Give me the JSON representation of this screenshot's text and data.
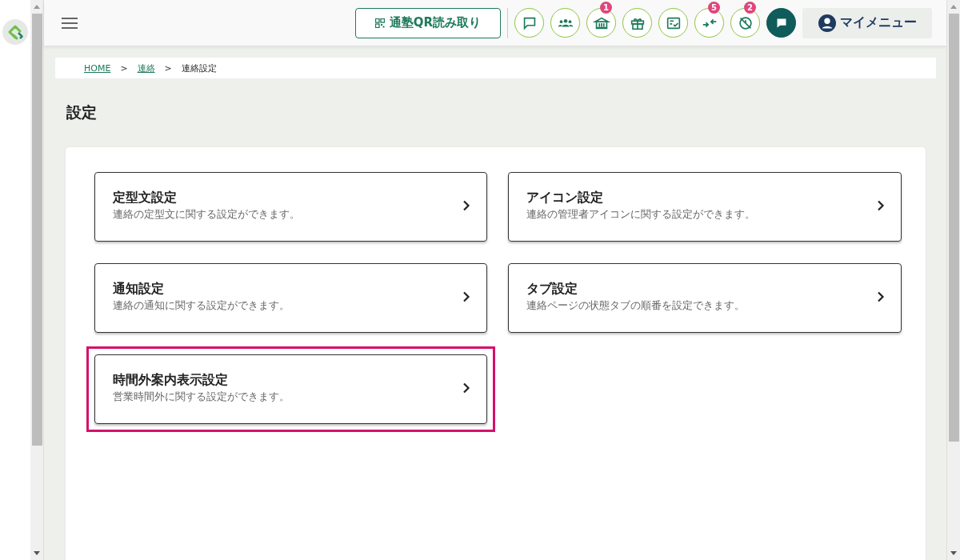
{
  "header": {
    "qr_button": "通塾QR読み取り",
    "icon_buttons": [
      {
        "kind": "chat"
      },
      {
        "kind": "group"
      },
      {
        "kind": "school",
        "badge": "1"
      },
      {
        "kind": "gift"
      },
      {
        "kind": "checklist"
      },
      {
        "kind": "arrows",
        "badge": "5"
      },
      {
        "kind": "clock-off",
        "badge": "2"
      },
      {
        "kind": "message"
      }
    ],
    "my_menu": "マイメニュー"
  },
  "breadcrumb": [
    {
      "label": "HOME",
      "link": true
    },
    {
      "label": "連絡",
      "link": true
    },
    {
      "label": "連絡設定",
      "link": false
    }
  ],
  "breadcrumb_separator": ">",
  "page_title": "設定",
  "cards": [
    {
      "title": "定型文設定",
      "description": "連絡の定型文に関する設定ができます。",
      "highlighted": false
    },
    {
      "title": "アイコン設定",
      "description": "連絡の管理者アイコンに関する設定ができます。",
      "highlighted": false
    },
    {
      "title": "通知設定",
      "description": "連絡の通知に関する設定ができます。",
      "highlighted": false
    },
    {
      "title": "タブ設定",
      "description": "連絡ページの状態タブの順番を設定できます。",
      "highlighted": false
    },
    {
      "title": "時間外案内表示設定",
      "description": "営業時間外に関する設定ができます。",
      "highlighted": true
    }
  ]
}
